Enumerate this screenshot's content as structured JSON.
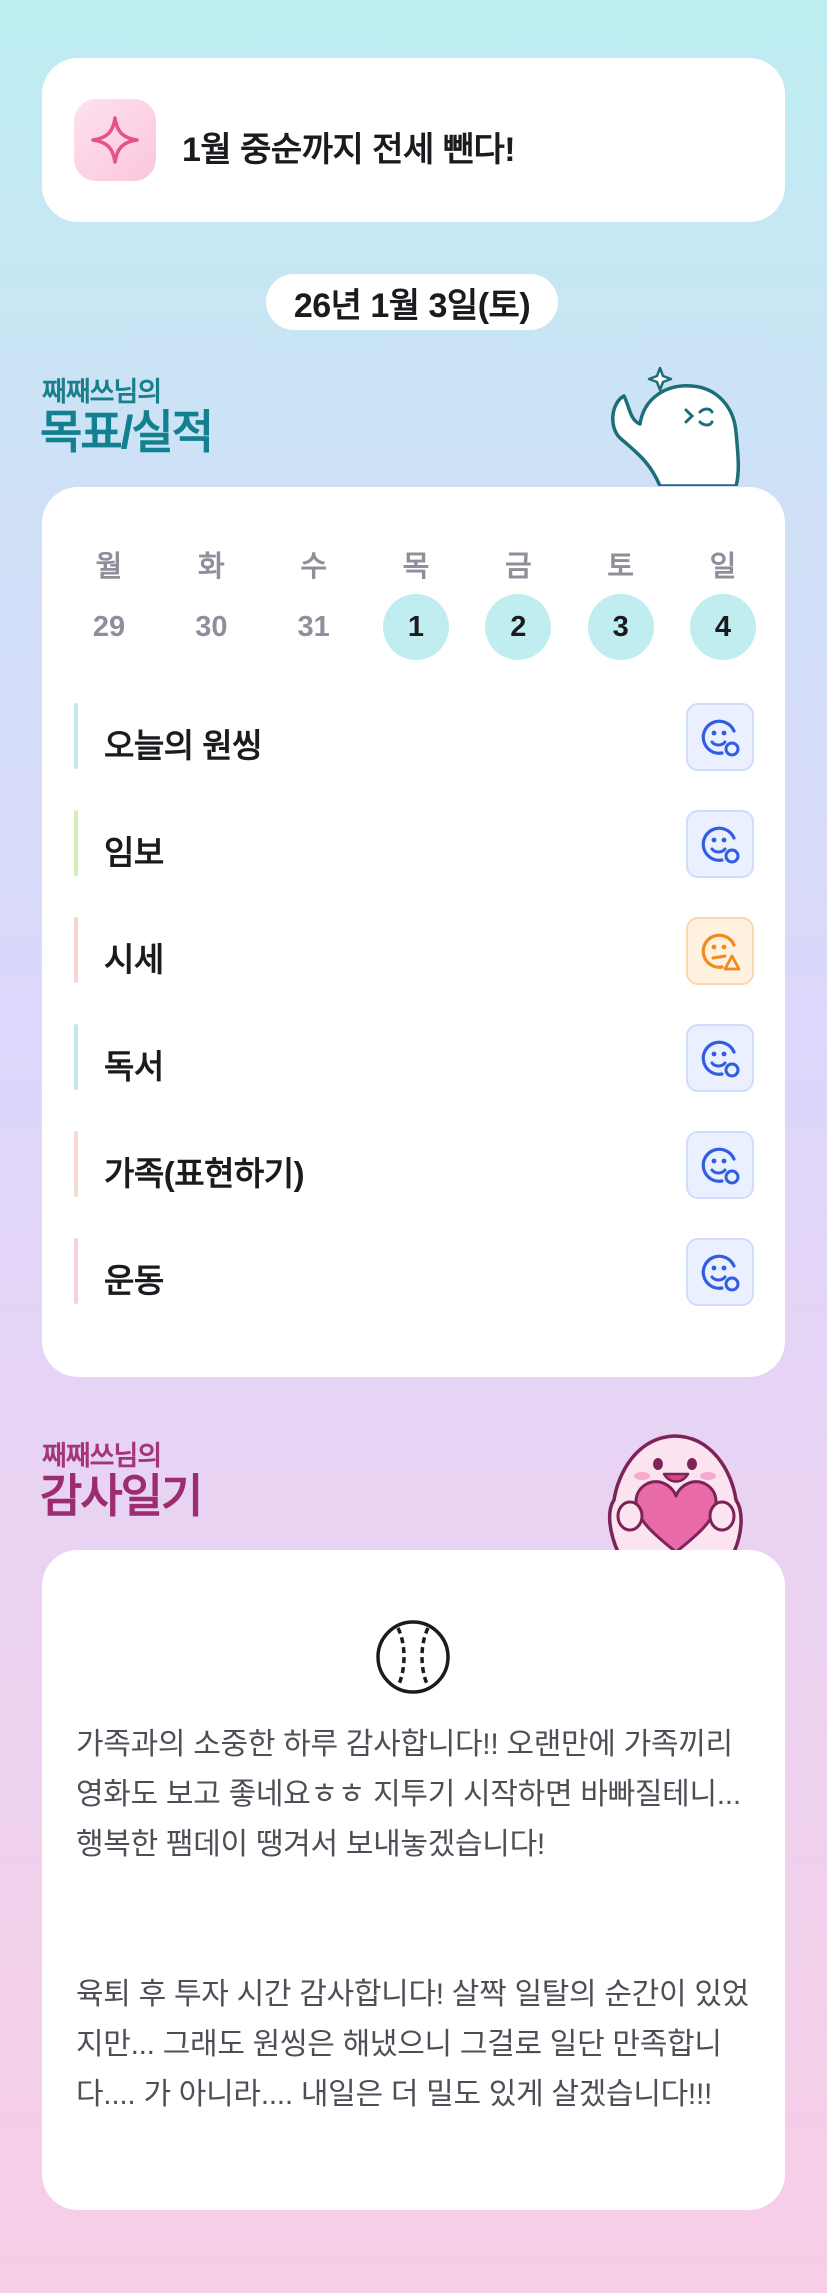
{
  "goal": {
    "text": "1월 중순까지 전세 뺀다!",
    "icon": "sparkle-icon"
  },
  "date_label": "26년 1월 3일(토)",
  "performance": {
    "subtitle": "째째쓰님의",
    "title": "목표/실적",
    "week": {
      "day_names": [
        "월",
        "화",
        "수",
        "목",
        "금",
        "토",
        "일"
      ],
      "day_numbers": [
        "29",
        "30",
        "31",
        "1",
        "2",
        "3",
        "4"
      ],
      "active_days": [
        false,
        false,
        false,
        true,
        true,
        true,
        true
      ]
    },
    "habits": [
      {
        "label": "오늘의 원씽",
        "accent": "#bfe9ef",
        "status": "smile-check-icon"
      },
      {
        "label": "임보",
        "accent": "#d4efb6",
        "status": "smile-check-icon"
      },
      {
        "label": "시세",
        "accent": "#f9d4d0",
        "status": "smile-warning-icon"
      },
      {
        "label": "독서",
        "accent": "#bfe9e6",
        "status": "smile-check-icon"
      },
      {
        "label": "가족(표현하기)",
        "accent": "#f8d9cf",
        "status": "smile-check-icon"
      },
      {
        "label": "운동",
        "accent": "#f7d2dc",
        "status": "smile-check-icon"
      }
    ]
  },
  "gratitude": {
    "subtitle": "째째쓰님의",
    "title": "감사일기",
    "icon": "baseball-icon",
    "paragraphs": [
      "가족과의 소중한 하루 감사합니다!! 오랜만에 가족끼리 영화도 보고 좋네요ㅎㅎ 지투기 시작하면 바빠질테니... 행복한 팸데이 땡겨서 보내놓겠습니다!",
      "육퇴 후 투자 시간 감사합니다! 살짝 일탈의 순간이 있었지만... 그래도 원씽은 해냈으니 그걸로 일단 만족합니다.... 가 아니라.... 내일은 더 밀도 있게 살겠습니다!!!"
    ]
  },
  "colors": {
    "teal": "#138090",
    "pink": "#9b2c6e",
    "check_blue": "#2f5fe0",
    "warn_orange": "#f08a1c"
  }
}
